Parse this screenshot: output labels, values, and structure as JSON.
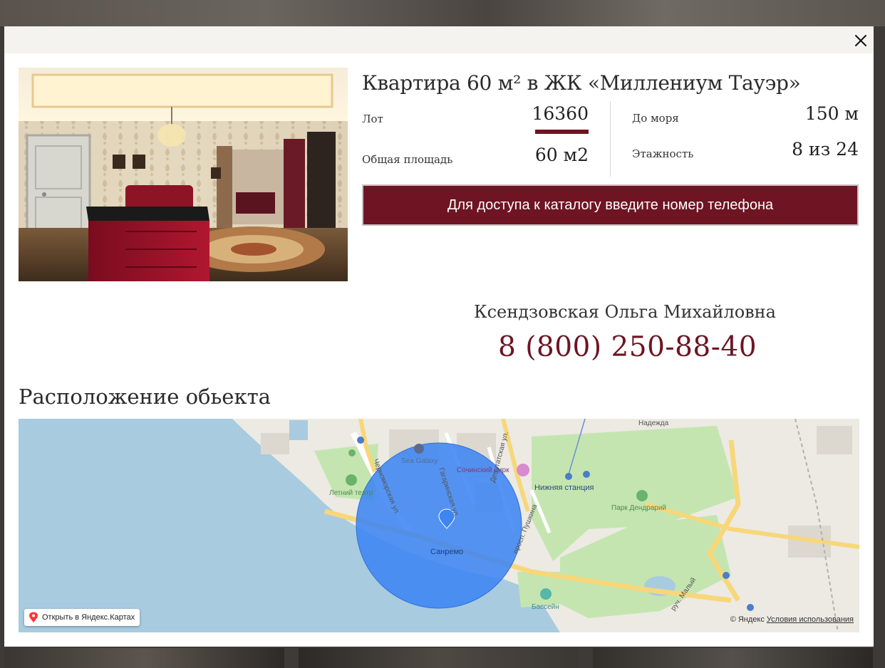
{
  "listing": {
    "title": "Квартира 60 м² в ЖК «Миллениум Тауэр»",
    "lot_label": "Лот",
    "lot_value": "16360",
    "area_label": "Общая площадь",
    "area_value": "60 м2",
    "sea_label": "До моря",
    "sea_value": "150 м",
    "floor_label": "Этажность",
    "floor_value": "8 из 24",
    "cta_label": "Для доступа к каталогу введите номер телефона"
  },
  "agent": {
    "name": "Ксендзовская Ольга Михайловна",
    "phone": "8 (800) 250-88-40"
  },
  "location": {
    "section_title": "Расположение обьекта"
  },
  "map": {
    "open_label": "Открыть в Яндекс.Картах",
    "copyright": "© Яндекс",
    "terms_label": "Условия использования",
    "labels": {
      "sea_galaxy": "Sea Galaxy",
      "circus": "Сочинский цирк",
      "summer_theater": "Летний театр",
      "lower_station": "Нижняя станция",
      "park": "Парк Дендрарий",
      "nadezhda": "Надежда",
      "sanremo": "Санремо",
      "pool": "Бассейн",
      "street_chernomorskaya": "Черноморская ул.",
      "street_gagarinskaya": "Гагаринская ул.",
      "street_deputatskaya": "Депутатская ул.",
      "street_pushkina": "просп. Пушкина",
      "stream_maly": "руч. Малый"
    }
  },
  "colors": {
    "accent": "#6e1423",
    "map_water": "#a8cbe0",
    "map_park": "#c4e5b0",
    "map_road": "#f7d77a",
    "map_circle": "#3e85f2"
  },
  "icons": {
    "close": "close-icon",
    "map_pin": "map-pin-icon"
  }
}
